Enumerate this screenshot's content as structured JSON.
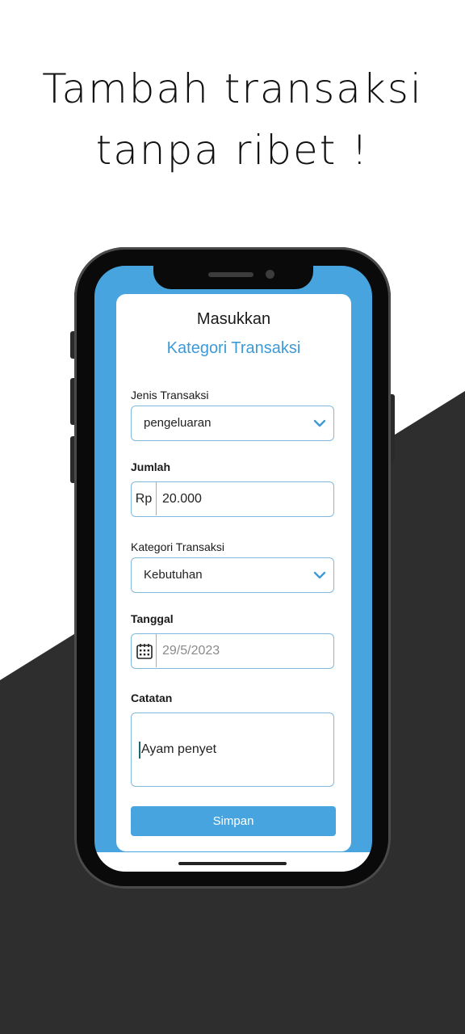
{
  "headline": {
    "line1": "Tambah transaksi",
    "line2": "tanpa ribet !"
  },
  "colors": {
    "accent": "#48a4de",
    "dark_background": "#2e2e2e",
    "field_border": "#7eb8dd"
  },
  "form": {
    "title": "Masukkan",
    "subtitle": "Kategori Transaksi",
    "jenis": {
      "label": "Jenis Transaksi",
      "value": "pengeluaran"
    },
    "jumlah": {
      "label": "Jumlah",
      "prefix": "Rp",
      "value": "20.000"
    },
    "kategori": {
      "label": "Kategori Transaksi",
      "value": "Kebutuhan"
    },
    "tanggal": {
      "label": "Tanggal",
      "value": "29/5/2023",
      "icon": "calendar-icon"
    },
    "catatan": {
      "label": "Catatan",
      "value": "Ayam penyet"
    },
    "submit_label": "Simpan"
  }
}
